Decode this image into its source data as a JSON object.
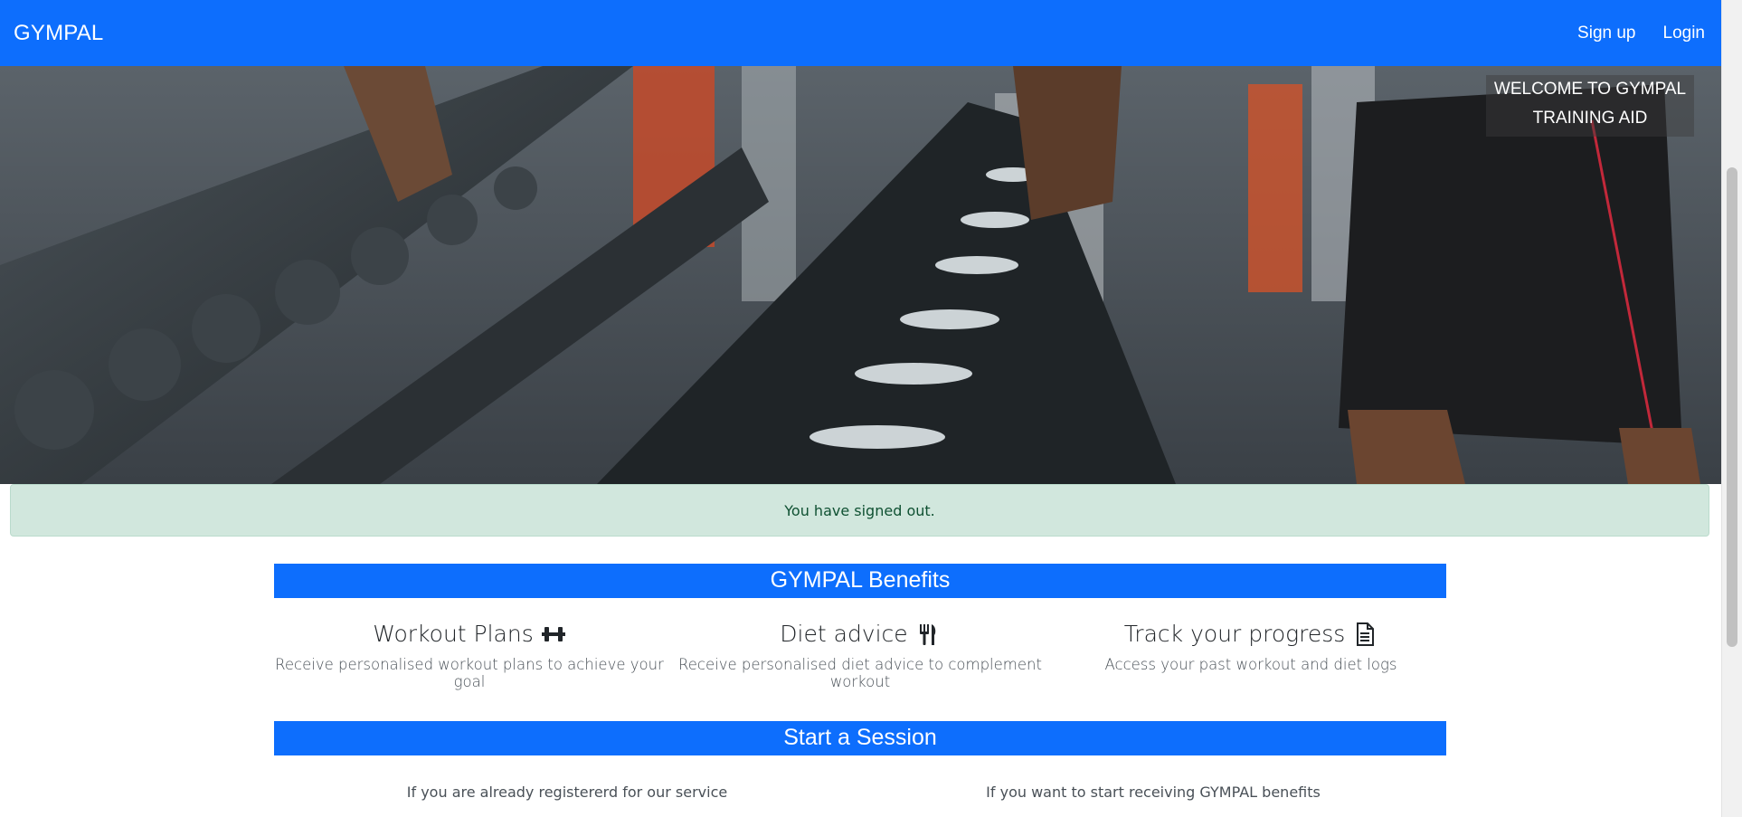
{
  "navbar": {
    "brand": "GYMPAL",
    "links": [
      {
        "label": "Sign up"
      },
      {
        "label": "Login"
      }
    ]
  },
  "hero": {
    "welcome_line1": "WELCOME TO GYMPAL",
    "welcome_line2": "TRAINING AID"
  },
  "alert": {
    "message": "You have signed out."
  },
  "benefits": {
    "heading": "GYMPAL Benefits",
    "items": [
      {
        "title": "Workout Plans",
        "icon": "dumbbell-icon",
        "description": "Receive personalised workout plans to achieve your goal"
      },
      {
        "title": "Diet advice",
        "icon": "utensils-icon",
        "description": "Receive personalised diet advice to complement workout"
      },
      {
        "title": "Track your progress",
        "icon": "document-icon",
        "description": "Access your past workout and diet logs"
      }
    ]
  },
  "session": {
    "heading": "Start a Session",
    "left_text": "If you are already registererd for our service",
    "right_text": "If you want to start receiving GYMPAL benefits"
  },
  "colors": {
    "primary": "#0d6efd",
    "alert_bg": "#d1e7dd",
    "alert_text": "#0f5132"
  }
}
